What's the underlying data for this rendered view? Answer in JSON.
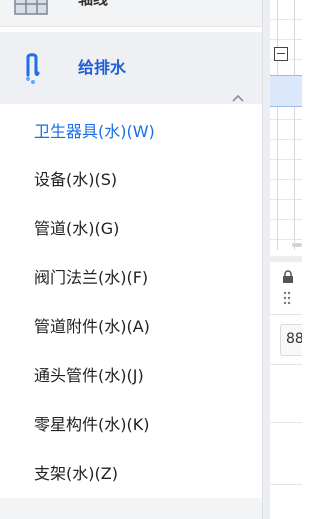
{
  "sidebar": {
    "previous_group": {
      "label": "轴线",
      "icon": "grid-icon"
    },
    "group": {
      "title": "给排水",
      "icon": "faucet-icon",
      "toggle_icon": "chevron-up-icon",
      "expanded": true
    },
    "items": [
      {
        "label": "卫生器具(水)(W)",
        "active": true
      },
      {
        "label": "设备(水)(S)",
        "active": false
      },
      {
        "label": "管道(水)(G)",
        "active": false
      },
      {
        "label": "阀门法兰(水)(F)",
        "active": false
      },
      {
        "label": "管道附件(水)(A)",
        "active": false
      },
      {
        "label": "通头管件(水)(J)",
        "active": false
      },
      {
        "label": "零星构件(水)(K)",
        "active": false
      },
      {
        "label": "支架(水)(Z)",
        "active": false
      }
    ]
  },
  "right_panel": {
    "collapse_icon": "minus-box-icon",
    "lock_icon": "lock-icon",
    "handle_icon": "drag-handle-icon",
    "partial_button_text": "88"
  },
  "colors": {
    "accent": "#1a6ee6",
    "group_title": "#1f5fd6",
    "header_bg": "#eef0f3",
    "selected_row": "#dbe8fb"
  }
}
